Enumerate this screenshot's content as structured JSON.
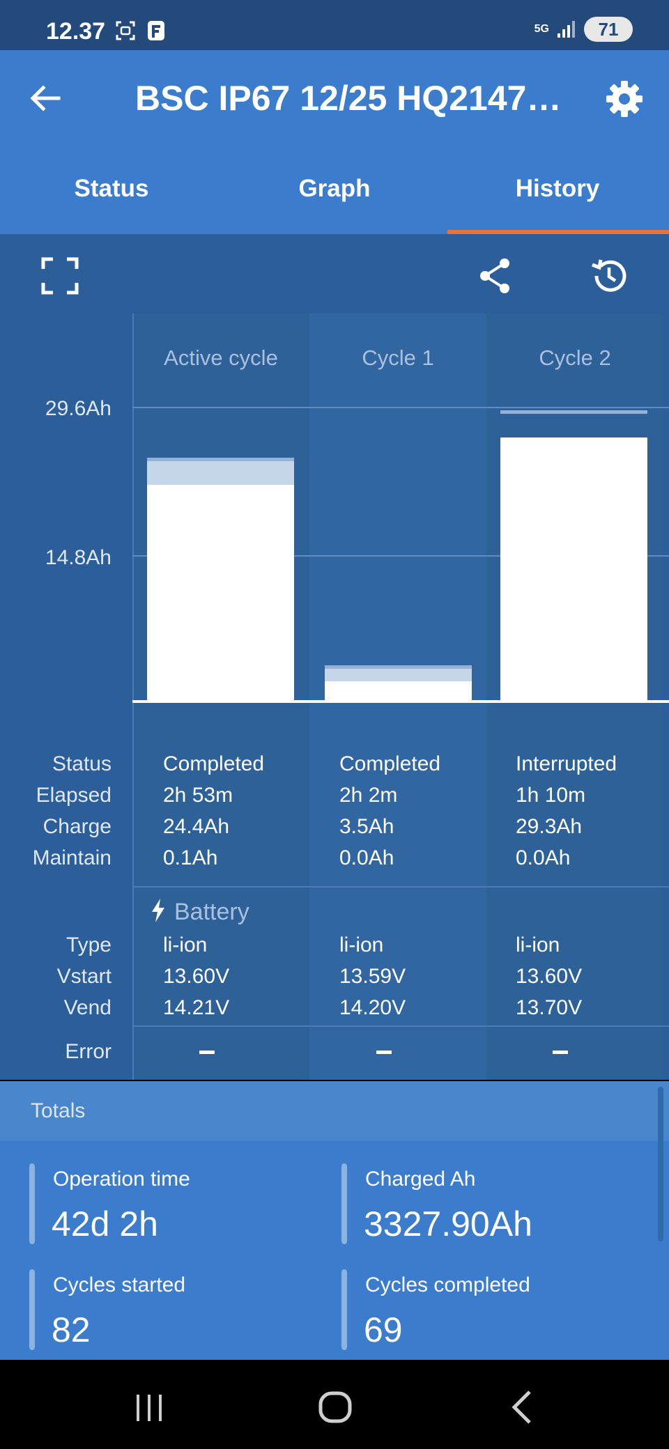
{
  "status_bar": {
    "time": "12.37",
    "network": "5G",
    "battery": "71"
  },
  "app_bar": {
    "title": "BSC IP67 12/25 HQ2147…"
  },
  "tabs": [
    {
      "label": "Status",
      "active": false
    },
    {
      "label": "Graph",
      "active": false
    },
    {
      "label": "History",
      "active": true
    }
  ],
  "chart_data": {
    "type": "bar",
    "categories": [
      "Active cycle",
      "Cycle 1",
      "Cycle 2"
    ],
    "y_ticks": [
      "29.6Ah",
      "14.8Ah"
    ],
    "ylim": [
      0,
      29.6
    ],
    "series": [
      {
        "name": "Charge",
        "values": [
          24.4,
          3.5,
          29.3
        ]
      },
      {
        "name": "Maintain",
        "values": [
          0.1,
          0.0,
          0.0
        ]
      }
    ]
  },
  "cycles": {
    "row_labels": {
      "status": "Status",
      "elapsed": "Elapsed",
      "charge": "Charge",
      "maintain": "Maintain"
    },
    "battery_title": "Battery",
    "battery_labels": {
      "type": "Type",
      "vstart": "Vstart",
      "vend": "Vend"
    },
    "error_label": "Error",
    "columns": [
      {
        "status": "Completed",
        "elapsed": "2h 53m",
        "charge": "24.4Ah",
        "maintain": "0.1Ah",
        "type": "li-ion",
        "vstart": "13.60V",
        "vend": "14.21V"
      },
      {
        "status": "Completed",
        "elapsed": "2h 2m",
        "charge": "3.5Ah",
        "maintain": "0.0Ah",
        "type": "li-ion",
        "vstart": "13.59V",
        "vend": "14.20V"
      },
      {
        "status": "Interrupted",
        "elapsed": "1h 10m",
        "charge": "29.3Ah",
        "maintain": "0.0Ah",
        "type": "li-ion",
        "vstart": "13.60V",
        "vend": "13.70V"
      }
    ]
  },
  "totals": {
    "title": "Totals",
    "items": [
      {
        "label": "Operation time",
        "value": "42d 2h"
      },
      {
        "label": "Charged Ah",
        "value": "3327.90Ah"
      },
      {
        "label": "Cycles started",
        "value": "82"
      },
      {
        "label": "Cycles completed",
        "value": "69"
      }
    ]
  },
  "colors": {
    "app_bar": "#3b7ccc",
    "accent": "#e8733a",
    "content_bg": "#2c5e99"
  },
  "icons": [
    "back-arrow-icon",
    "gear-icon",
    "fullscreen-icon",
    "share-icon",
    "history-icon",
    "bolt-icon",
    "recents-icon",
    "home-icon",
    "back-icon"
  ]
}
